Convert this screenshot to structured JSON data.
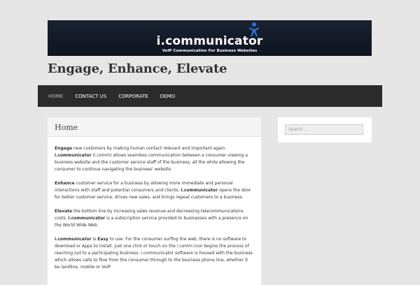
{
  "banner": {
    "title": "i.communicator",
    "tagline": "VoIP Communication For Business Websites",
    "icon": "person-icon",
    "colors": {
      "background": "#141b28",
      "icon": "#2f6fd8"
    }
  },
  "site": {
    "title": "Engage, Enhance, Elevate"
  },
  "nav": {
    "items": [
      {
        "label": "HOME",
        "active": true
      },
      {
        "label": "CONTACT US",
        "active": false
      },
      {
        "label": "CORPORATE",
        "active": false
      },
      {
        "label": "DEMO",
        "active": false
      }
    ]
  },
  "page": {
    "title": "Home",
    "paragraphs": [
      {
        "lead": "Engage",
        "p1": " new customers by making human contact relevant and important again. ",
        "brand": "i.communicator",
        "p2": " (i.comm) allows seamless communication between a consumer viewing a business website and the customer service staff of the business; all the while allowing the consumer to continue navigating the business' website."
      },
      {
        "lead": "Enhance",
        "p1": " customer service for a business by allowing more immediate and personal interactions with staff and potential consumers and clients. ",
        "brand": "i.communicator",
        "p2": " opens the door for better customer service, drives new sales, and brings repeat customers to a business."
      },
      {
        "lead": "Elevate",
        "p1": " the bottom line by increasing sales revenue and decreasing telecommunications costs. ",
        "brand": "i.communicator",
        "p2": " is a subscription service provided to businesses with a presence on the World Wide Web."
      },
      {
        "lead": "i.communicator",
        "p1": " is ",
        "brand": "Easy",
        "p2": " to use. For the consumer surfing the web, there is no software to download or Apps to install. Just one click or touch on the i.comm Icon begins the process of reaching out to a participating business. i.communicator software is housed with the business which allows calls to flow from the consumer through to the business phone line, whether it be landline, mobile or VoIP."
      }
    ]
  },
  "sidebar": {
    "search": {
      "placeholder": "Search ...",
      "value": ""
    }
  },
  "colors": {
    "background": "#e6e6e6",
    "navbar": "#2b2b2b",
    "panel": "#ffffff"
  }
}
